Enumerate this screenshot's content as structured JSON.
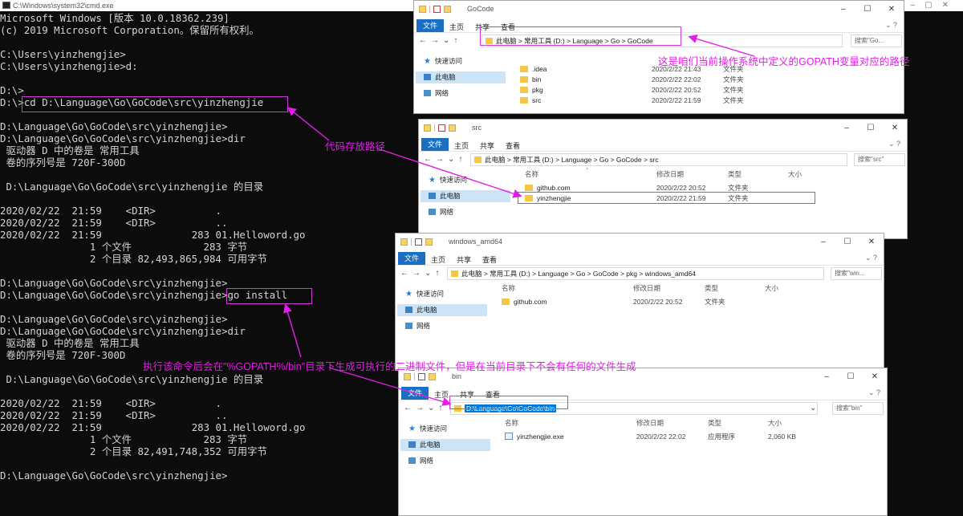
{
  "cmd": {
    "title": "C:\\Windows\\system32\\cmd.exe",
    "lines": [
      "Microsoft Windows [版本 10.0.18362.239]",
      "(c) 2019 Microsoft Corporation。保留所有权利。",
      "",
      "C:\\Users\\yinzhengjie>",
      "C:\\Users\\yinzhengjie>d:",
      "",
      "D:\\>",
      "D:\\>cd D:\\Language\\Go\\GoCode\\src\\yinzhengjie",
      "",
      "D:\\Language\\Go\\GoCode\\src\\yinzhengjie>",
      "D:\\Language\\Go\\GoCode\\src\\yinzhengjie>dir",
      " 驱动器 D 中的卷是 常用工具",
      " 卷的序列号是 720F-300D",
      "",
      " D:\\Language\\Go\\GoCode\\src\\yinzhengjie 的目录",
      "",
      "2020/02/22  21:59    <DIR>          .",
      "2020/02/22  21:59    <DIR>          ..",
      "2020/02/22  21:59               283 01.Helloword.go",
      "               1 个文件            283 字节",
      "               2 个目录 82,493,865,984 可用字节",
      "",
      "D:\\Language\\Go\\GoCode\\src\\yinzhengjie>",
      "D:\\Language\\Go\\GoCode\\src\\yinzhengjie>go install",
      "",
      "D:\\Language\\Go\\GoCode\\src\\yinzhengjie>",
      "D:\\Language\\Go\\GoCode\\src\\yinzhengjie>dir",
      " 驱动器 D 中的卷是 常用工具",
      " 卷的序列号是 720F-300D",
      "",
      " D:\\Language\\Go\\GoCode\\src\\yinzhengjie 的目录",
      "",
      "2020/02/22  21:59    <DIR>          .",
      "2020/02/22  21:59    <DIR>          ..",
      "2020/02/22  21:59               283 01.Helloword.go",
      "               1 个文件            283 字节",
      "               2 个目录 82,491,748,352 可用字节",
      "",
      "D:\\Language\\Go\\GoCode\\src\\yinzhengjie>"
    ]
  },
  "ribbon": {
    "file": "文件",
    "home": "主页",
    "share": "共享",
    "view": "查看"
  },
  "nav": {
    "quick": "快速访问",
    "pc": "此电脑",
    "network": "网络"
  },
  "cols": {
    "name": "名称",
    "modified": "修改日期",
    "type": "类型",
    "size": "大小"
  },
  "win1": {
    "title": "GoCode",
    "crumbs": "此电脑  >  常用工具 (D:)  >  Language  >  Go  >  GoCode",
    "search": "搜索\"Go...",
    "rows": [
      {
        "name": ".idea",
        "date": "2020/2/22 21:43",
        "type": "文件夹"
      },
      {
        "name": "bin",
        "date": "2020/2/22 22:02",
        "type": "文件夹"
      },
      {
        "name": "pkg",
        "date": "2020/2/22 20:52",
        "type": "文件夹"
      },
      {
        "name": "src",
        "date": "2020/2/22 21:59",
        "type": "文件夹"
      }
    ]
  },
  "win2": {
    "title": "src",
    "crumbs": "此电脑  >  常用工具 (D:)  >  Language  >  Go  >  GoCode  >  src",
    "search": "搜索\"src\"",
    "rows": [
      {
        "name": "github.com",
        "date": "2020/2/22 20:52",
        "type": "文件夹"
      },
      {
        "name": "yinzhengjie",
        "date": "2020/2/22 21:59",
        "type": "文件夹"
      }
    ]
  },
  "win3": {
    "title": "windows_amd64",
    "crumbs": "此电脑  >  常用工具 (D:)  >  Language  >  Go  >  GoCode  >  pkg  >  windows_amd64",
    "search": "搜索\"win...",
    "rows": [
      {
        "name": "github.com",
        "date": "2020/2/22 20:52",
        "type": "文件夹"
      }
    ]
  },
  "win4": {
    "title": "bin",
    "path": "D:\\Language\\Go\\GoCode\\bin",
    "search": "搜索\"bin\"",
    "rows": [
      {
        "name": "yinzhengjie.exe",
        "date": "2020/2/22 22:02",
        "type": "应用程序",
        "size": "2,060 KB"
      }
    ]
  },
  "notes": {
    "gopath": "这是咱们当前操作系统中定义的GOPATH变量对应的路径",
    "code": "代码存放路径",
    "install": "执行该命令后会在\"%GOPATH%/bin\"目录下生成可执行的二进制文件，但是在当前目录下不会有任何的文件生成"
  },
  "colors": {
    "accent": "#1a6fc2",
    "annotation": "#e01ee8",
    "selection": "#cce4f7",
    "folder": "#f5c748"
  }
}
